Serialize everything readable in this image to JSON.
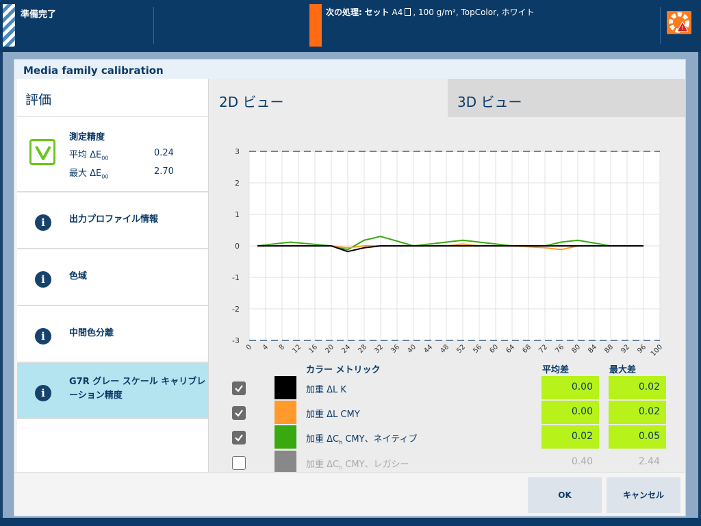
{
  "topbar": {
    "status": "準備完了",
    "next_label": "次の処理:",
    "next_job": "セット",
    "next_details_size": "A4",
    "next_details_rest": ", 100 g/m², TopColor, ホワイト",
    "status_color": "#ff6a13"
  },
  "dialog": {
    "title": "Media family calibration",
    "left_header": "評価",
    "accuracy": {
      "title": "測定精度",
      "avg_label": "平均 ΔE",
      "avg_sub": "00",
      "avg_value": "0.24",
      "max_label": "最大 ΔE",
      "max_sub": "00",
      "max_value": "2.70",
      "icon": "check-icon"
    },
    "items": [
      {
        "label": "出力プロファイル情報",
        "icon": "info-icon"
      },
      {
        "label": "色域",
        "icon": "info-icon"
      },
      {
        "label": "中間色分離",
        "icon": "info-icon"
      },
      {
        "label": "G7R グレー スケール キャリブレーション精度",
        "icon": "info-icon",
        "active": true
      }
    ],
    "tabs": {
      "view2d": "2D ビュー",
      "view3d": "3D ビュー"
    },
    "metrics": {
      "header_name": "カラー メトリック",
      "header_avg": "平均差",
      "header_max": "最大差",
      "rows": [
        {
          "name": "加重 ΔL K",
          "avg": "0.00",
          "max": "0.02",
          "checked": true,
          "color": "#000000"
        },
        {
          "name": "加重 ΔL CMY",
          "avg": "0.00",
          "max": "0.02",
          "checked": true,
          "color": "#ff9a2b"
        },
        {
          "name_main": "加重 ΔC",
          "name_sub": "h",
          "name_rest": " CMY、ネイティブ",
          "avg": "0.02",
          "max": "0.05",
          "checked": true,
          "color": "#3aa80f"
        },
        {
          "name_main": "加重 ΔC",
          "name_sub": "h",
          "name_rest": " CMY、レガシー",
          "avg": "0.40",
          "max": "2.44",
          "checked": false,
          "color": "#888888"
        }
      ]
    },
    "buttons": {
      "ok": "OK",
      "cancel": "キャンセル"
    }
  },
  "chart_data": {
    "type": "line",
    "title": "",
    "xlabel": "",
    "ylabel": "",
    "xlim": [
      0,
      100
    ],
    "ylim": [
      -3,
      3
    ],
    "x_ticks": [
      0,
      4,
      8,
      12,
      16,
      20,
      24,
      28,
      32,
      36,
      40,
      44,
      48,
      52,
      56,
      60,
      64,
      68,
      72,
      76,
      80,
      84,
      88,
      92,
      96,
      100
    ],
    "y_ticks": [
      3,
      2,
      1,
      0,
      -1,
      -2,
      -3
    ],
    "tolerance_lines": [
      3,
      -3
    ],
    "grid": true,
    "x": [
      2,
      10,
      20,
      24,
      28,
      32,
      40,
      48,
      52,
      56,
      64,
      72,
      76,
      80,
      88,
      96
    ],
    "series": [
      {
        "color": "#3aa80f",
        "values": [
          0,
          0.02,
          0,
          -0.02,
          0.03,
          0.05,
          0,
          0.02,
          0.03,
          0.02,
          0,
          0,
          0.02,
          0.03,
          0,
          0
        ]
      },
      {
        "color": "#ff9a2b",
        "values": [
          0,
          0,
          0,
          -0.01,
          0,
          0,
          0,
          0,
          0.01,
          0,
          0,
          -0.01,
          -0.02,
          0,
          0,
          0
        ]
      },
      {
        "color": "#000000",
        "values": [
          0,
          0,
          0,
          -0.03,
          -0.01,
          0,
          0,
          0,
          0,
          0,
          0,
          0,
          0,
          0,
          0,
          0
        ]
      }
    ]
  }
}
